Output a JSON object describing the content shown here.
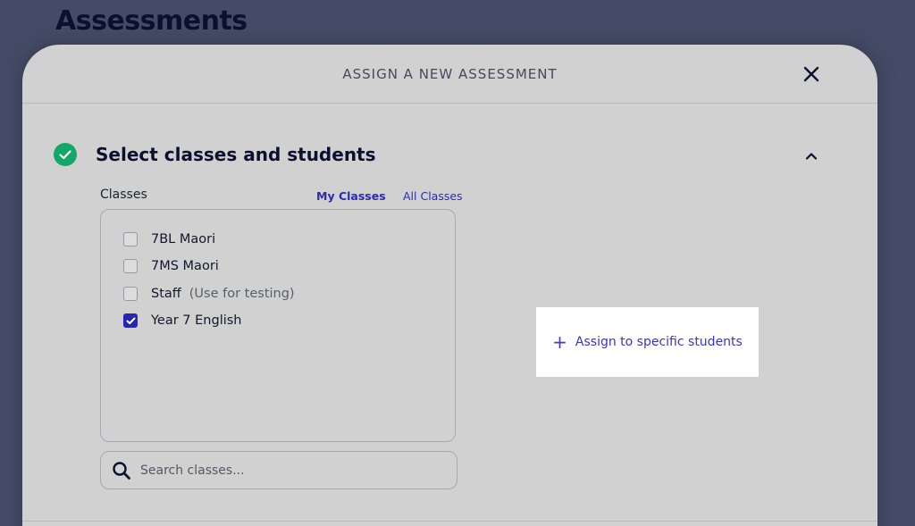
{
  "page": {
    "title": "Assessments"
  },
  "modal": {
    "title": "ASSIGN A NEW ASSESSMENT",
    "close_icon": "close-icon"
  },
  "section": {
    "title": "Select classes and students",
    "status_icon": "check-circle-icon",
    "status_color": "#12a86a",
    "collapse_icon": "chevron-up-icon"
  },
  "classes": {
    "label": "Classes",
    "filters": {
      "my_classes": "My Classes",
      "all_classes": "All Classes"
    },
    "items": [
      {
        "name": "7BL Maori",
        "note": "",
        "checked": false
      },
      {
        "name": "7MS Maori",
        "note": "",
        "checked": false
      },
      {
        "name": "Staff",
        "note": "(Use for testing)",
        "checked": false
      },
      {
        "name": "Year 7 English",
        "note": "",
        "checked": true
      }
    ],
    "search": {
      "placeholder": "Search classes...",
      "value": ""
    }
  },
  "assign": {
    "label": "Assign to specific students",
    "icon": "plus-icon"
  },
  "colors": {
    "accent": "#2626b5",
    "backdrop": "#444b66",
    "modal": "#d1d1d1"
  }
}
